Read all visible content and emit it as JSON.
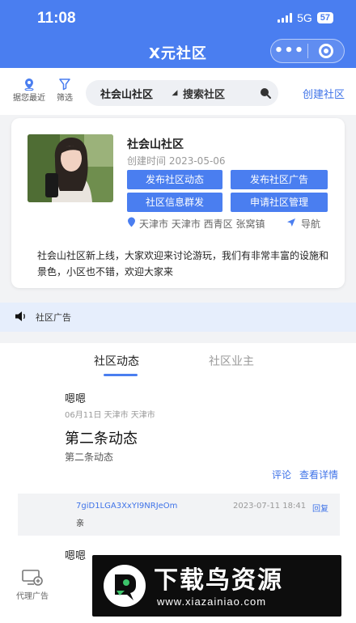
{
  "status_bar": {
    "time": "11:08",
    "network": "5G",
    "battery": "57"
  },
  "nav": {
    "title": "X元社区"
  },
  "toolbar": {
    "nearby_label": "据您最近",
    "filter_label": "筛选",
    "search": {
      "selected_community": "社会山社区",
      "placeholder": "搜索社区"
    },
    "create_label": "创建社区"
  },
  "community": {
    "name": "社会山社区",
    "created": "创建时间 2023-05-06",
    "buttons": [
      "发布社区动态",
      "发布社区广告",
      "社区信息群发",
      "申请社区管理"
    ],
    "location": "天津市 天津市 西青区 张窝镇",
    "navigate_label": "导航",
    "description": "社会山社区新上线，大家欢迎来讨论游玩，我们有非常丰富的设施和景色，小区也不错，欢迎大家来"
  },
  "ad_bar": {
    "label": "社区广告"
  },
  "tabs": [
    {
      "label": "社区动态",
      "active": true
    },
    {
      "label": "社区业主",
      "active": false
    }
  ],
  "posts": [
    {
      "author": "嗯嗯",
      "meta": "06月11日  天津市  天津市",
      "title": "第二条动态",
      "body": "第二条动态",
      "comment_label": "评论",
      "detail_label": "查看详情",
      "comment": {
        "user": "7giD1LGA3XxYI9NRJeOm",
        "time": "2023-07-11 18:41",
        "reply_label": "回复",
        "text": "亲"
      }
    },
    {
      "author": "嗯嗯"
    }
  ],
  "bottom": {
    "agent_ad_label": "代理广告"
  },
  "watermark": {
    "title": "下载鸟资源",
    "url": "www.xiazainiao.com"
  },
  "colors": {
    "primary": "#4a7ef0",
    "link": "#3f73e8",
    "background": "#f2f3f5",
    "ad_bar": "#e6eefc"
  }
}
